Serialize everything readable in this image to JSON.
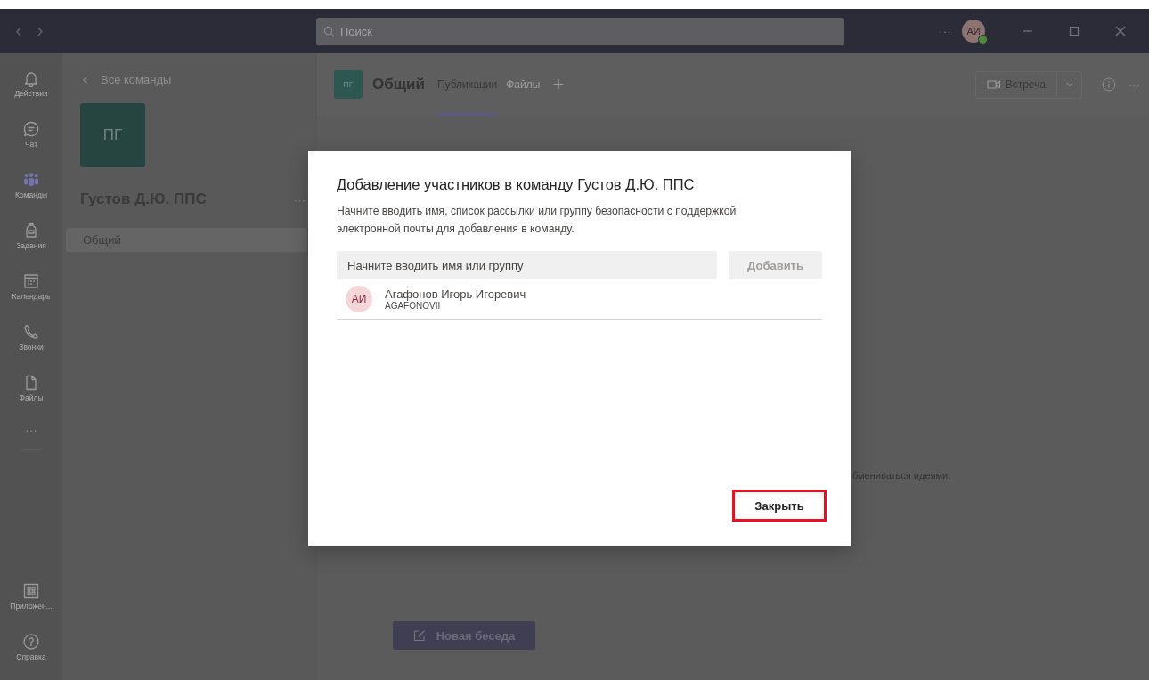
{
  "title_bar": {
    "nav": [
      "‹",
      "›"
    ],
    "search": {
      "placeholder": "Поиск"
    },
    "more": "···",
    "avatar": {
      "initials": "АИ",
      "online": true
    }
  },
  "rail": {
    "items": [
      {
        "label": "Действия",
        "kind": "bell",
        "selected": false
      },
      {
        "label": "Чат",
        "kind": "chat",
        "selected": false
      },
      {
        "label": "Команды",
        "kind": "teams",
        "selected": true
      },
      {
        "label": "Задания",
        "kind": "backpack",
        "selected": false
      },
      {
        "label": "Календарь",
        "kind": "calendar",
        "selected": false
      },
      {
        "label": "Звонки",
        "kind": "phone",
        "selected": false
      },
      {
        "label": "Файлы",
        "kind": "file",
        "selected": false
      }
    ],
    "more": "···",
    "bottom_items": [
      {
        "label": "Приложен...",
        "kind": "apps",
        "selected": false
      },
      {
        "label": "Справка",
        "kind": "help",
        "selected": false
      }
    ]
  },
  "team_pane": {
    "back_link": "Все команды",
    "team_tile": "ПГ",
    "team_name": "Густов Д.Ю. ППС",
    "more": "···",
    "channels": [
      {
        "label": "Общий",
        "selected": true
      }
    ]
  },
  "channel_header": {
    "tile": "ПГ",
    "name": "Общий",
    "tabs": [
      {
        "label": "Публикации",
        "selected": true
      },
      {
        "label": "Файлы",
        "selected": false
      }
    ],
    "add_tab": "+",
    "meet_button": "Встреча",
    "more": "···"
  },
  "channel_body": {
    "hint": "бмениваться идеями.",
    "new_conversation": "Новая беседа"
  },
  "dialog": {
    "title": "Добавление участников в команду Густов Д.Ю. ППС",
    "description": "Начните вводить имя, список рассылки или группу безопасности с поддержкой электронной почты для добавления в команду.",
    "input": {
      "placeholder": "Начните вводить имя или группу"
    },
    "add_button": {
      "label": "Добавить",
      "disabled": true
    },
    "members": [
      {
        "initials": "АИ",
        "name": "Агафонов Игорь Игоревич",
        "login": "AGAFONOVII"
      }
    ],
    "close_button": {
      "label": "Закрыть",
      "highlighted": true
    }
  }
}
